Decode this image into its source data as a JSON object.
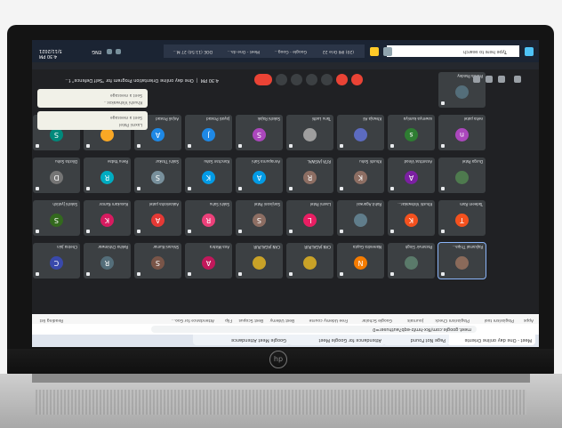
{
  "browser": {
    "tabs": [
      {
        "label": "Meet - One day online Oriente"
      },
      {
        "label": "Page Not Found"
      },
      {
        "label": "Attendance for Google Meet"
      },
      {
        "label": "Google Meet Attendance"
      }
    ],
    "url": "meet.google.com/fkx-hmfz-eqb?authuser=0",
    "bookmarks": [
      "Apps",
      "Plagiarism tool",
      "Plagiarism Check",
      "Journals",
      "Google Scholar",
      "Free Udemy course",
      "Best Udemy",
      "Best Scopus",
      "Flip",
      "Attendance for Goo...",
      "Reading list"
    ]
  },
  "meeting": {
    "time": "4:30 PM",
    "title": "One day online Orientation Program for \"Self Defence\" f...",
    "participants": [
      {
        "name": "Rajkamal Thipa...",
        "initial": "",
        "color": "#8a6a5a"
      },
      {
        "name": "Paramvir Singh",
        "initial": "",
        "color": "#5a7a6a"
      },
      {
        "name": "Narendra Gupta",
        "initial": "N",
        "color": "#f57c00"
      },
      {
        "name": "CAN JAGALPUR",
        "initial": "",
        "color": "#c9a227"
      },
      {
        "name": "CAN JAGALPUR",
        "initial": "",
        "color": "#c9a227"
      },
      {
        "name": "Ana Mishra",
        "initial": "A",
        "color": "#c2185b"
      },
      {
        "name": "Shivani Kumar",
        "initial": "S",
        "color": "#795548"
      },
      {
        "name": "Rekha Chhimwar",
        "initial": "R",
        "color": "#546e7a"
      },
      {
        "name": "Chetna Jain",
        "initial": "C",
        "color": "#3949ab"
      },
      {
        "name": "Tadeem Ram",
        "initial": "T",
        "color": "#f4511e"
      },
      {
        "name": "Khushi Vishwakar...",
        "initial": "K",
        "color": "#f4511e"
      },
      {
        "name": "Rohit Agarwal",
        "initial": "",
        "color": "#607d8b"
      },
      {
        "name": "Laxmi Patel",
        "initial": "L",
        "color": "#e91e63"
      },
      {
        "name": "Sanjivani Patel",
        "initial": "S",
        "color": "#8d6e63"
      },
      {
        "name": "Sakhi Sahu",
        "initial": "R",
        "color": "#ec407a"
      },
      {
        "name": "Aakanksha patel",
        "initial": "A",
        "color": "#e53935"
      },
      {
        "name": "Kusukam Kumar",
        "initial": "K",
        "color": "#d81b60"
      },
      {
        "name": "Sakshi Jyotish",
        "initial": "S",
        "color": "#33691e"
      },
      {
        "name": "Durga Patel",
        "initial": "",
        "color": "#4e7a4e"
      },
      {
        "name": "Ananthas Vinod",
        "initial": "A",
        "color": "#7b1fa2"
      },
      {
        "name": "Khushi Sahu",
        "initial": "K",
        "color": "#8d6e63"
      },
      {
        "name": "RITA JAISWAL",
        "initial": "R",
        "color": "#8d6e63"
      },
      {
        "name": "Annapurna Sahi",
        "initial": "A",
        "color": "#039be5"
      },
      {
        "name": "Kanchan Sahu",
        "initial": "K",
        "color": "#039be5"
      },
      {
        "name": "Sakhi Thakur",
        "initial": "S",
        "color": "#78909c"
      },
      {
        "name": "Renu Yadav",
        "initial": "R",
        "color": "#00acc1"
      },
      {
        "name": "Diksha Sahu",
        "initial": "D",
        "color": "#757575"
      },
      {
        "name": "neha patel",
        "initial": "n",
        "color": "#ab47bc"
      },
      {
        "name": "sowmya kumiya",
        "initial": "s",
        "color": "#2e7d32"
      },
      {
        "name": "Khwaja Ali",
        "initial": "",
        "color": "#5c6bc0"
      },
      {
        "name": "Tanu Lodhi",
        "initial": "",
        "color": "#9e9e9e"
      },
      {
        "name": "Sakshi Rajak",
        "initial": "S",
        "color": "#ab47bc"
      },
      {
        "name": "Jayati Prasad",
        "initial": "J",
        "color": "#1e88e5"
      },
      {
        "name": "Anjali Prasad",
        "initial": "A",
        "color": "#1e88e5"
      },
      {
        "name": "Pooja Chaturvedi",
        "initial": "",
        "color": "#f9a825"
      },
      {
        "name": "Sakshi Sahu",
        "initial": "S",
        "color": "#00897b"
      },
      {
        "name": "Prerna Pandey",
        "initial": "",
        "color": "#546e7a"
      }
    ],
    "notifications": [
      {
        "line1": "Laxmi Patel",
        "line2": "Sent a message"
      },
      {
        "line1": "Khushi Vishwakar...",
        "line2": "Sent a message"
      }
    ]
  },
  "taskbar": {
    "search_placeholder": "Type here to search",
    "apps": [
      "(20) IMI Orie 22",
      "Google - Goog...",
      "Meet - One da...",
      "DOE (11:54) 27 M..."
    ],
    "time": "4:30 PM",
    "date": "5/11/2021",
    "lang": "ENG"
  },
  "brand": "hp"
}
